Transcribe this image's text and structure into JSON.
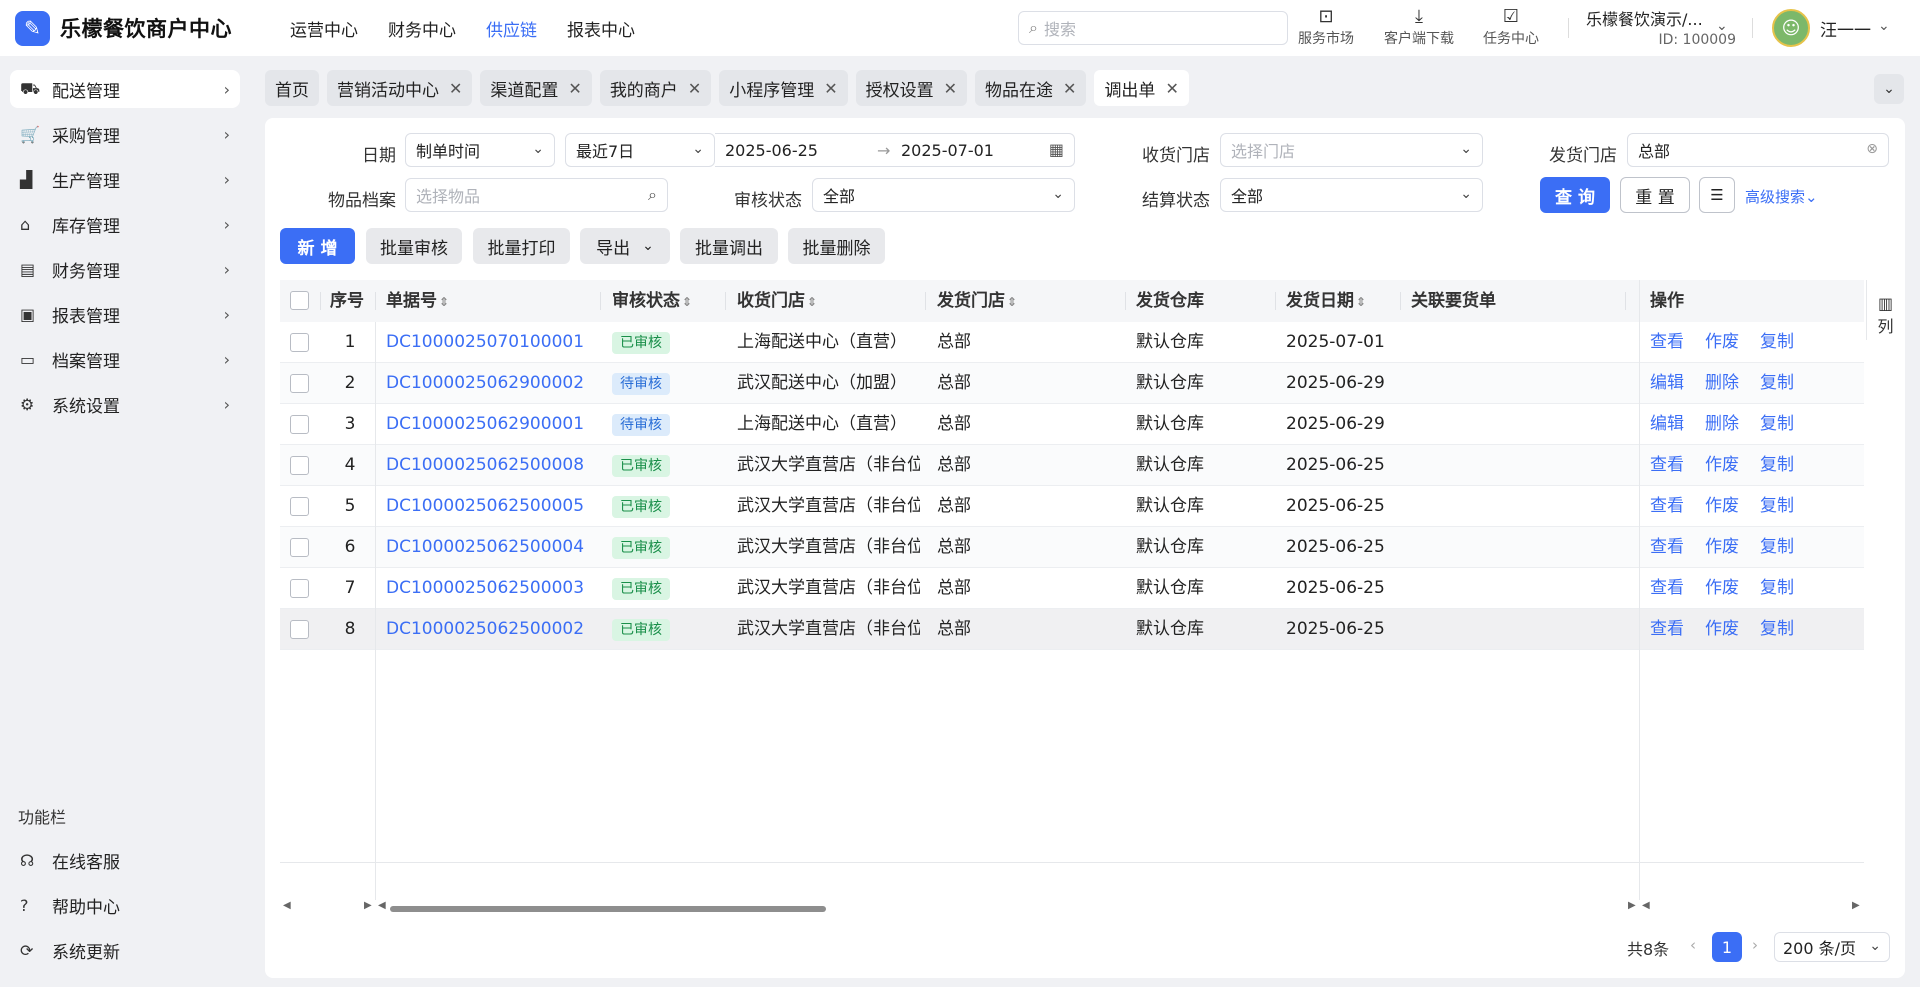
{
  "app": {
    "logo_text": "乐檬餐饮商户中心"
  },
  "topnav": [
    {
      "label": "运营中心",
      "active": false
    },
    {
      "label": "财务中心",
      "active": false
    },
    {
      "label": "供应链",
      "active": true
    },
    {
      "label": "报表中心",
      "active": false
    }
  ],
  "search": {
    "placeholder": "搜索"
  },
  "tools": [
    {
      "label": "服务市场",
      "icon": "shop-icon"
    },
    {
      "label": "客户端下载",
      "icon": "download-icon"
    },
    {
      "label": "任务中心",
      "icon": "task-icon"
    }
  ],
  "merchant": {
    "name": "乐檬餐饮演示/...",
    "id": "ID: 100009"
  },
  "user": {
    "name": "汪一一"
  },
  "sidebar": {
    "items": [
      {
        "label": "配送管理",
        "icon": "truck-icon",
        "glyph": "⛟",
        "active": true
      },
      {
        "label": "采购管理",
        "icon": "cart-icon",
        "glyph": "🛒",
        "active": false
      },
      {
        "label": "生产管理",
        "icon": "factory-icon",
        "glyph": "▟",
        "active": false
      },
      {
        "label": "库存管理",
        "icon": "warehouse-icon",
        "glyph": "⌂",
        "active": false
      },
      {
        "label": "财务管理",
        "icon": "finance-icon",
        "glyph": "▤",
        "active": false
      },
      {
        "label": "报表管理",
        "icon": "report-icon",
        "glyph": "▣",
        "active": false
      },
      {
        "label": "档案管理",
        "icon": "archive-icon",
        "glyph": "▭",
        "active": false
      },
      {
        "label": "系统设置",
        "icon": "gear-icon",
        "glyph": "⚙",
        "active": false
      }
    ],
    "section_title": "功能栏",
    "bottom": [
      {
        "label": "在线客服",
        "icon": "headset-icon",
        "glyph": "☊"
      },
      {
        "label": "帮助中心",
        "icon": "help-icon",
        "glyph": "?"
      },
      {
        "label": "系统更新",
        "icon": "refresh-icon",
        "glyph": "⟳"
      }
    ]
  },
  "tabs": [
    {
      "label": "首页",
      "closable": false,
      "active": false
    },
    {
      "label": "营销活动中心",
      "closable": true,
      "active": false
    },
    {
      "label": "渠道配置",
      "closable": true,
      "active": false
    },
    {
      "label": "我的商户",
      "closable": true,
      "active": false
    },
    {
      "label": "小程序管理",
      "closable": true,
      "active": false
    },
    {
      "label": "授权设置",
      "closable": true,
      "active": false
    },
    {
      "label": "物品在途",
      "closable": true,
      "active": false
    },
    {
      "label": "调出单",
      "closable": true,
      "active": true
    }
  ],
  "filters": {
    "date_label": "日期",
    "date_type": "制单时间",
    "date_range_preset": "最近7日",
    "date_start": "2025-06-25",
    "date_end": "2025-07-01",
    "receive_store_label": "收货门店",
    "receive_store_placeholder": "选择门店",
    "ship_store_label": "发货门店",
    "ship_store_value": "总部",
    "item_label": "物品档案",
    "item_placeholder": "选择物品",
    "audit_label": "审核状态",
    "audit_value": "全部",
    "settle_label": "结算状态",
    "settle_value": "全部",
    "query_btn": "查 询",
    "reset_btn": "重 置",
    "advanced": "高级搜索"
  },
  "actions": {
    "add": "新 增",
    "batch_audit": "批量审核",
    "batch_print": "批量打印",
    "export": "导出",
    "batch_transfer": "批量调出",
    "batch_delete": "批量删除"
  },
  "table": {
    "headers": {
      "seq": "序号",
      "order_no": "单据号",
      "audit": "审核状态",
      "receive_store": "收货门店",
      "ship_store": "发货门店",
      "warehouse": "发货仓库",
      "ship_date": "发货日期",
      "related": "关联要货单",
      "ops": "操作"
    },
    "rows": [
      {
        "seq": "1",
        "order_no": "DC1000025070100001",
        "audit": "已审核",
        "receive_store": "上海配送中心（直营）",
        "ship_store": "总部",
        "warehouse": "默认仓库",
        "ship_date": "2025-07-01",
        "related": "",
        "ops": [
          "查看",
          "作废",
          "复制"
        ]
      },
      {
        "seq": "2",
        "order_no": "DC1000025062900002",
        "audit": "待审核",
        "receive_store": "武汉配送中心（加盟）",
        "ship_store": "总部",
        "warehouse": "默认仓库",
        "ship_date": "2025-06-29",
        "related": "",
        "ops": [
          "编辑",
          "删除",
          "复制"
        ]
      },
      {
        "seq": "3",
        "order_no": "DC1000025062900001",
        "audit": "待审核",
        "receive_store": "上海配送中心（直营）",
        "ship_store": "总部",
        "warehouse": "默认仓库",
        "ship_date": "2025-06-29",
        "related": "",
        "ops": [
          "编辑",
          "删除",
          "复制"
        ]
      },
      {
        "seq": "4",
        "order_no": "DC1000025062500008",
        "audit": "已审核",
        "receive_store": "武汉大学直营店（非台位",
        "ship_store": "总部",
        "warehouse": "默认仓库",
        "ship_date": "2025-06-25",
        "related": "",
        "ops": [
          "查看",
          "作废",
          "复制"
        ]
      },
      {
        "seq": "5",
        "order_no": "DC1000025062500005",
        "audit": "已审核",
        "receive_store": "武汉大学直营店（非台位",
        "ship_store": "总部",
        "warehouse": "默认仓库",
        "ship_date": "2025-06-25",
        "related": "",
        "ops": [
          "查看",
          "作废",
          "复制"
        ]
      },
      {
        "seq": "6",
        "order_no": "DC1000025062500004",
        "audit": "已审核",
        "receive_store": "武汉大学直营店（非台位",
        "ship_store": "总部",
        "warehouse": "默认仓库",
        "ship_date": "2025-06-25",
        "related": "",
        "ops": [
          "查看",
          "作废",
          "复制"
        ]
      },
      {
        "seq": "7",
        "order_no": "DC1000025062500003",
        "audit": "已审核",
        "receive_store": "武汉大学直营店（非台位",
        "ship_store": "总部",
        "warehouse": "默认仓库",
        "ship_date": "2025-06-25",
        "related": "",
        "ops": [
          "查看",
          "作废",
          "复制"
        ]
      },
      {
        "seq": "8",
        "order_no": "DC1000025062500002",
        "audit": "已审核",
        "receive_store": "武汉大学直营店（非台位",
        "ship_store": "总部",
        "warehouse": "默认仓库",
        "ship_date": "2025-06-25",
        "related": "",
        "ops": [
          "查看",
          "作废",
          "复制"
        ]
      }
    ],
    "column_toggle": "列"
  },
  "pagination": {
    "total": "共8条",
    "current": "1",
    "page_size": "200 条/页"
  },
  "colors": {
    "primary": "#3b6ef5",
    "approved_bg": "#d9f5e3",
    "approved_fg": "#1a8f4a",
    "pending_bg": "#dcebfb",
    "pending_fg": "#2a6ed6"
  }
}
